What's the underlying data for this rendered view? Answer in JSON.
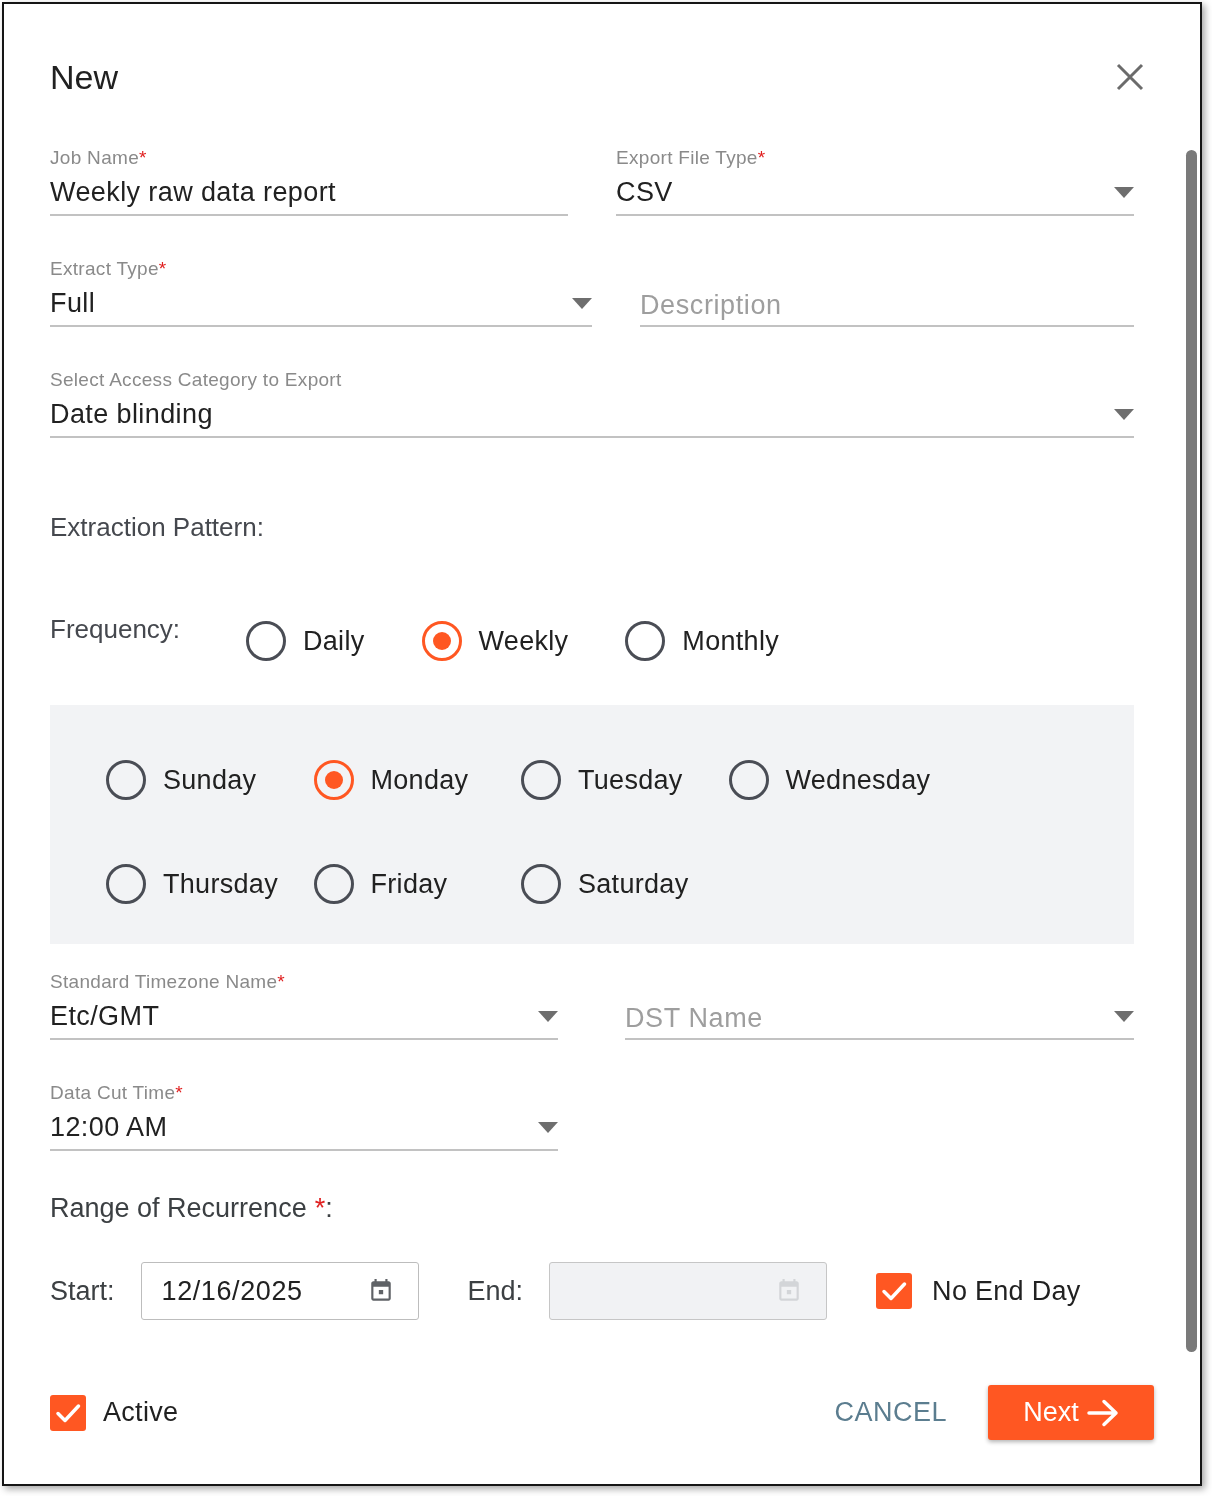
{
  "dialog": {
    "title": "New"
  },
  "form_rows": [
    {
      "fields": [
        {
          "kind": "text",
          "label": "Job Name",
          "required_mark": "*",
          "value": "Weekly raw data report"
        },
        {
          "kind": "select",
          "label": "Export File Type",
          "required_mark": "*",
          "value": "CSV"
        }
      ]
    },
    {
      "fields": [
        {
          "kind": "select",
          "label": "Extract Type",
          "required_mark": "*",
          "value": "Full"
        },
        {
          "kind": "text",
          "placeholder": "Description"
        }
      ]
    },
    {
      "fields": [
        {
          "kind": "select",
          "label": "Select Access Category to Export",
          "value": "Date blinding"
        }
      ]
    }
  ],
  "extraction_pattern": {
    "title": "Extraction Pattern:",
    "frequency": {
      "label": "Frequency:",
      "options": [
        {
          "label": "Daily",
          "selected": false
        },
        {
          "label": "Weekly",
          "selected": true
        },
        {
          "label": "Monthly",
          "selected": false
        }
      ]
    },
    "days": [
      {
        "label": "Sunday",
        "selected": false
      },
      {
        "label": "Monday",
        "selected": true
      },
      {
        "label": "Tuesday",
        "selected": false
      },
      {
        "label": "Wednesday",
        "selected": false
      },
      {
        "label": "Thursday",
        "selected": false
      },
      {
        "label": "Friday",
        "selected": false
      },
      {
        "label": "Saturday",
        "selected": false
      }
    ]
  },
  "schedule_rows": [
    {
      "fields": [
        {
          "kind": "select",
          "label": "Standard Timezone Name",
          "required_mark": "*",
          "value": "Etc/GMT"
        },
        {
          "kind": "select",
          "placeholder": "DST Name"
        }
      ]
    },
    {
      "fields": [
        {
          "kind": "select",
          "label": "Data Cut Time",
          "required_mark": "*",
          "value": "12:00 AM"
        }
      ]
    }
  ],
  "range_of_recurrence": {
    "title": "Range of Recurrence",
    "required_mark": "*",
    "suffix": ":",
    "start": {
      "label": "Start:",
      "value": "12/16/2025",
      "disabled": false
    },
    "end": {
      "label": "End:",
      "disabled": true
    },
    "no_end_day": {
      "label": "No End Day",
      "checked": true
    }
  },
  "active": {
    "label": "Active",
    "checked": true
  },
  "buttons": [
    {
      "kind": "text",
      "label": "CANCEL"
    },
    {
      "kind": "primary",
      "label": "Next"
    }
  ]
}
